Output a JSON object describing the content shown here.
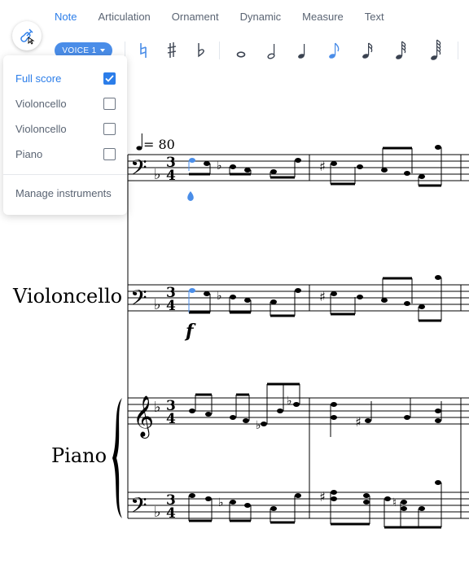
{
  "tabs": [
    "Note",
    "Articulation",
    "Ornament",
    "Dynamic",
    "Measure",
    "Text"
  ],
  "active_tab": "Note",
  "toolbar": {
    "voice_label": "VOICE 1",
    "accidental_icons": [
      "natural-icon",
      "sharp-icon",
      "flat-icon"
    ],
    "duration_icons": [
      "whole-note-icon",
      "half-note-icon",
      "quarter-note-icon",
      "eighth-note-icon",
      "sixteenth-note-icon",
      "thirty-second-note-icon",
      "sixty-fourth-note-icon"
    ],
    "selected_duration": "eighth-note-icon"
  },
  "instrument_menu": {
    "items": [
      {
        "label": "Full score",
        "checked": true
      },
      {
        "label": "Violoncello",
        "checked": false
      },
      {
        "label": "Violoncello",
        "checked": false
      },
      {
        "label": "Piano",
        "checked": false
      }
    ],
    "manage_label": "Manage instruments"
  },
  "score": {
    "tempo_text": "= 80",
    "dynamic_text": "f",
    "time_signature": "3 4",
    "instrument_labels": {
      "cello": "Violoncello",
      "piano": "Piano"
    }
  },
  "colors": {
    "accent": "#2b7de9",
    "voice_button": "#4a8de8",
    "selected_note": "#4a8de8"
  }
}
